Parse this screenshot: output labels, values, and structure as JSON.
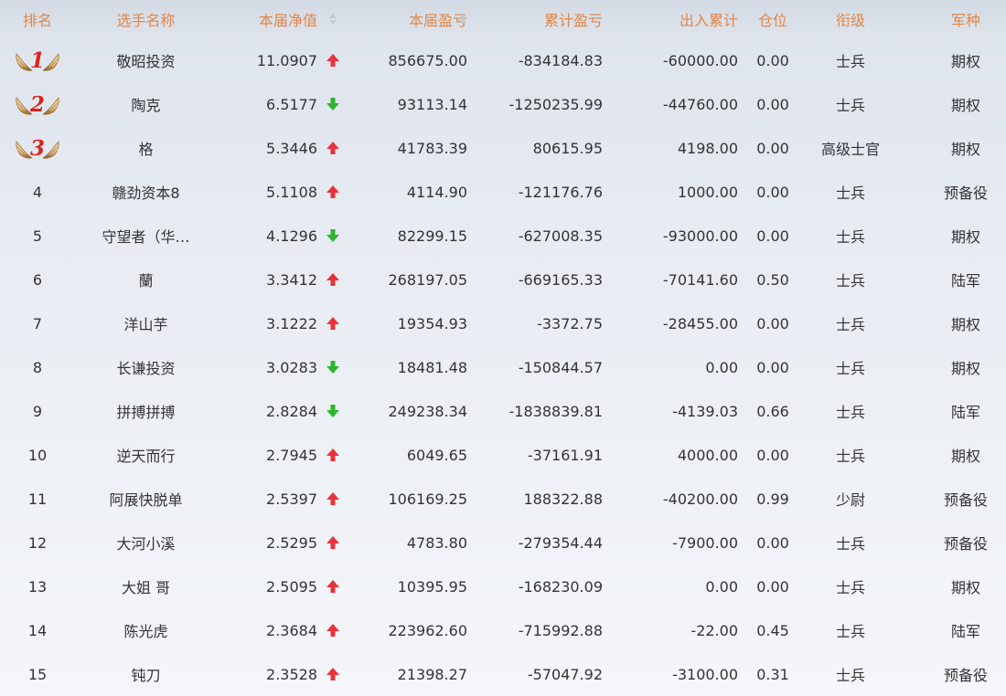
{
  "header": {
    "rank": "排名",
    "name": "选手名称",
    "nav": "本届净值",
    "pl": "本届盈亏",
    "cum": "累计盈亏",
    "flow": "出入累计",
    "pos": "仓位",
    "grade": "衔级",
    "arm": "军种"
  },
  "colors": {
    "header_text": "#e0874a",
    "up_arrow": "#e8323c",
    "down_arrow": "#2db52d",
    "medal_number": "#d9231a"
  },
  "rows": [
    {
      "rank": "1",
      "name": "敬昭投资",
      "nav": "11.0907",
      "dir": "up",
      "pl": "856675.00",
      "cum": "-834184.83",
      "flow": "-60000.00",
      "pos": "0.00",
      "grade": "士兵",
      "arm": "期权"
    },
    {
      "rank": "2",
      "name": "陶克",
      "nav": "6.5177",
      "dir": "down",
      "pl": "93113.14",
      "cum": "-1250235.99",
      "flow": "-44760.00",
      "pos": "0.00",
      "grade": "士兵",
      "arm": "期权"
    },
    {
      "rank": "3",
      "name": "格",
      "nav": "5.3446",
      "dir": "up",
      "pl": "41783.39",
      "cum": "80615.95",
      "flow": "4198.00",
      "pos": "0.00",
      "grade": "高级士官",
      "arm": "期权"
    },
    {
      "rank": "4",
      "name": "赣劲资本8",
      "nav": "5.1108",
      "dir": "up",
      "pl": "4114.90",
      "cum": "-121176.76",
      "flow": "1000.00",
      "pos": "0.00",
      "grade": "士兵",
      "arm": "预备役"
    },
    {
      "rank": "5",
      "name": "守望者（华…",
      "nav": "4.1296",
      "dir": "down",
      "pl": "82299.15",
      "cum": "-627008.35",
      "flow": "-93000.00",
      "pos": "0.00",
      "grade": "士兵",
      "arm": "期权"
    },
    {
      "rank": "6",
      "name": "蘭",
      "nav": "3.3412",
      "dir": "up",
      "pl": "268197.05",
      "cum": "-669165.33",
      "flow": "-70141.60",
      "pos": "0.50",
      "grade": "士兵",
      "arm": "陆军"
    },
    {
      "rank": "7",
      "name": "洋山芋",
      "nav": "3.1222",
      "dir": "up",
      "pl": "19354.93",
      "cum": "-3372.75",
      "flow": "-28455.00",
      "pos": "0.00",
      "grade": "士兵",
      "arm": "期权"
    },
    {
      "rank": "8",
      "name": "长谦投资",
      "nav": "3.0283",
      "dir": "down",
      "pl": "18481.48",
      "cum": "-150844.57",
      "flow": "0.00",
      "pos": "0.00",
      "grade": "士兵",
      "arm": "期权"
    },
    {
      "rank": "9",
      "name": "拼搏拼搏",
      "nav": "2.8284",
      "dir": "down",
      "pl": "249238.34",
      "cum": "-1838839.81",
      "flow": "-4139.03",
      "pos": "0.66",
      "grade": "士兵",
      "arm": "陆军"
    },
    {
      "rank": "10",
      "name": "逆天而行",
      "nav": "2.7945",
      "dir": "up",
      "pl": "6049.65",
      "cum": "-37161.91",
      "flow": "4000.00",
      "pos": "0.00",
      "grade": "士兵",
      "arm": "期权"
    },
    {
      "rank": "11",
      "name": "阿展快脱单",
      "nav": "2.5397",
      "dir": "up",
      "pl": "106169.25",
      "cum": "188322.88",
      "flow": "-40200.00",
      "pos": "0.99",
      "grade": "少尉",
      "arm": "预备役"
    },
    {
      "rank": "12",
      "name": "大河小溪",
      "nav": "2.5295",
      "dir": "up",
      "pl": "4783.80",
      "cum": "-279354.44",
      "flow": "-7900.00",
      "pos": "0.00",
      "grade": "士兵",
      "arm": "预备役"
    },
    {
      "rank": "13",
      "name": "大姐 哥",
      "nav": "2.5095",
      "dir": "up",
      "pl": "10395.95",
      "cum": "-168230.09",
      "flow": "0.00",
      "pos": "0.00",
      "grade": "士兵",
      "arm": "期权"
    },
    {
      "rank": "14",
      "name": "陈光虎",
      "nav": "2.3684",
      "dir": "up",
      "pl": "223962.60",
      "cum": "-715992.88",
      "flow": "-22.00",
      "pos": "0.45",
      "grade": "士兵",
      "arm": "陆军"
    },
    {
      "rank": "15",
      "name": "钝刀",
      "nav": "2.3528",
      "dir": "up",
      "pl": "21398.27",
      "cum": "-57047.92",
      "flow": "-3100.00",
      "pos": "0.31",
      "grade": "士兵",
      "arm": "预备役"
    }
  ]
}
